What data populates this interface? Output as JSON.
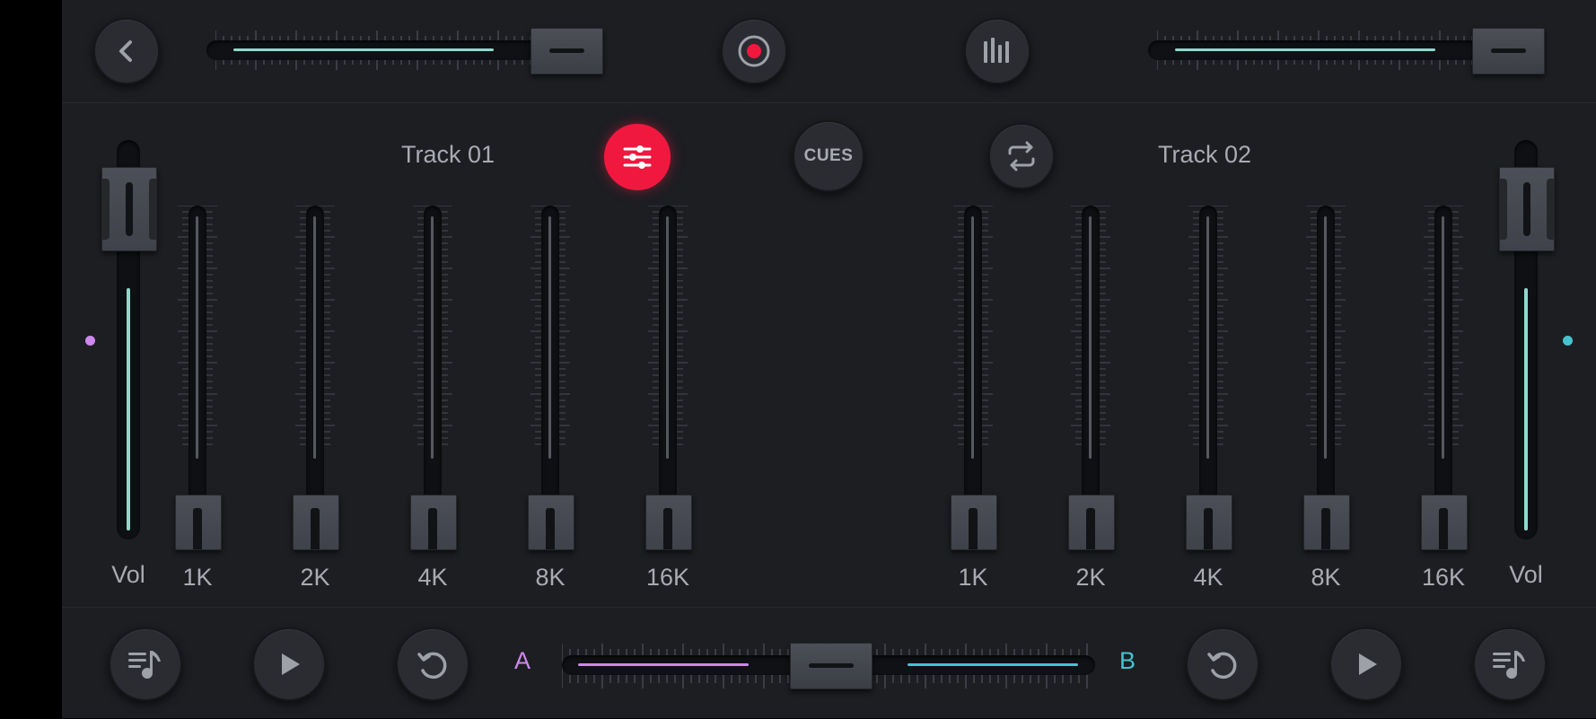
{
  "colors": {
    "accent_red": "#f0183f",
    "deck_a": "#cc88ee",
    "deck_b": "#45c4cf",
    "teal_fill": "#8fd8cc"
  },
  "top": {
    "back_icon": "chevron-left-icon",
    "record_icon": "record-icon",
    "visualizer_icon": "equalizer-bars-icon"
  },
  "deck_a": {
    "title": "Track 01",
    "eq_button_icon": "sliders-icon",
    "volume_label": "Vol",
    "volume_level": 0.7,
    "pitch_level": 0.86,
    "eq_bands": [
      {
        "label": "1K",
        "level": 0.0
      },
      {
        "label": "2K",
        "level": 0.0
      },
      {
        "label": "4K",
        "level": 0.0
      },
      {
        "label": "8K",
        "level": 0.0
      },
      {
        "label": "16K",
        "level": 0.0
      }
    ]
  },
  "center": {
    "cues_label": "CUES",
    "loop_icon": "repeat-icon"
  },
  "deck_b": {
    "title": "Track 02",
    "volume_label": "Vol",
    "volume_level": 0.7,
    "pitch_level": 0.86,
    "eq_bands": [
      {
        "label": "1K",
        "level": 0.0
      },
      {
        "label": "2K",
        "level": 0.0
      },
      {
        "label": "4K",
        "level": 0.0
      },
      {
        "label": "8K",
        "level": 0.0
      },
      {
        "label": "16K",
        "level": 0.0
      }
    ]
  },
  "crossfader": {
    "label_a": "A",
    "label_b": "B",
    "position": 0.5
  },
  "bottom": {
    "playlist_icon": "playlist-icon",
    "play_icon": "play-icon",
    "reset_icon": "undo-icon"
  }
}
